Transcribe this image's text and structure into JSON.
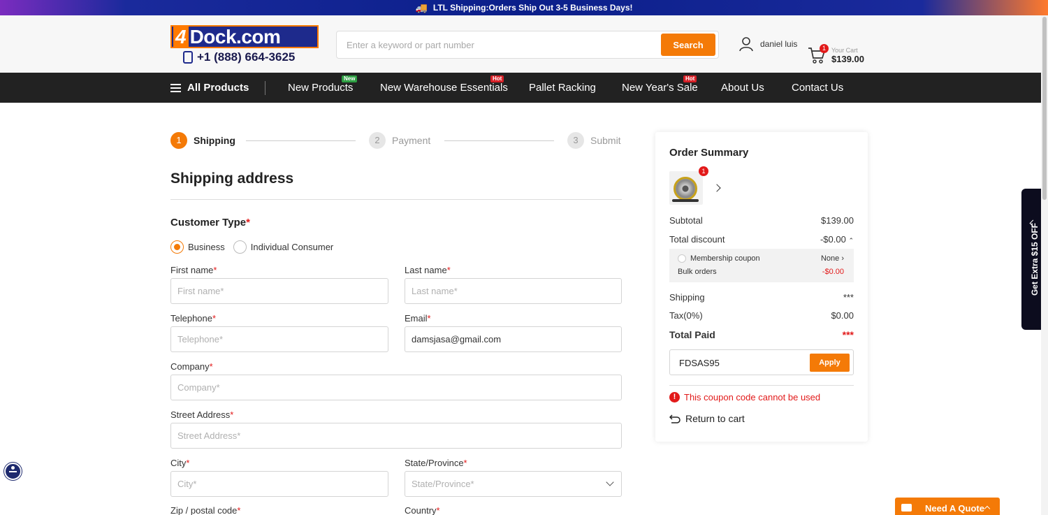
{
  "banner": {
    "text": "LTL Shipping:Orders Ship Out 3-5 Business Days!",
    "icon": "truck-icon"
  },
  "header": {
    "logo_text": "4Dock.com",
    "phone": "+1 (888) 664-3625",
    "search_placeholder": "Enter a keyword or part number",
    "search_button": "Search",
    "user_name": "daniel luis",
    "cart_count": "1",
    "cart_label": "Your Cart",
    "cart_total": "$139.00"
  },
  "nav": {
    "all_products": "All Products",
    "items": [
      {
        "label": "New Products",
        "badge": "New"
      },
      {
        "label": "New Warehouse Essentials",
        "badge": "Hot"
      },
      {
        "label": "Pallet Racking",
        "badge": ""
      },
      {
        "label": "New Year's Sale",
        "badge": "Hot"
      },
      {
        "label": "About Us",
        "badge": ""
      },
      {
        "label": "Contact Us",
        "badge": ""
      }
    ]
  },
  "steps": [
    {
      "num": "1",
      "label": "Shipping",
      "active": true
    },
    {
      "num": "2",
      "label": "Payment",
      "active": false
    },
    {
      "num": "3",
      "label": "Submit",
      "active": false
    }
  ],
  "form": {
    "title": "Shipping address",
    "customer_type_label": "Customer Type",
    "customer_types": [
      "Business",
      "Individual Consumer"
    ],
    "selected_customer_type": "Business",
    "first_name": {
      "label": "First name",
      "placeholder": "First name*",
      "value": ""
    },
    "last_name": {
      "label": "Last name",
      "placeholder": "Last name*",
      "value": ""
    },
    "telephone": {
      "label": "Telephone",
      "placeholder": "Telephone*",
      "value": ""
    },
    "email": {
      "label": "Email",
      "placeholder": "Email*",
      "value": "damsjasa@gmail.com"
    },
    "company": {
      "label": "Company",
      "placeholder": "Company*",
      "value": ""
    },
    "street": {
      "label": "Street Address",
      "placeholder": "Street Address*",
      "value": ""
    },
    "city": {
      "label": "City",
      "placeholder": "City*",
      "value": ""
    },
    "state": {
      "label": "State/Province",
      "placeholder": "State/Province*"
    },
    "zip": {
      "label": "Zip / postal code"
    },
    "country": {
      "label": "Country"
    },
    "required_mark": "*"
  },
  "summary": {
    "title": "Order Summary",
    "item_qty": "1",
    "subtotal_label": "Subtotal",
    "subtotal": "$139.00",
    "discount_label": "Total discount",
    "discount": "-$0.00",
    "membership_label": "Membership coupon",
    "membership_value": "None",
    "bulk_label": "Bulk orders",
    "bulk_value": "-$0.00",
    "shipping_label": "Shipping",
    "shipping": "***",
    "tax_label": "Tax(0%)",
    "tax": "$0.00",
    "total_label": "Total Paid",
    "total": "***",
    "coupon_value": "FDSAS95",
    "apply_label": "Apply",
    "error": "This coupon code cannot be used",
    "return_label": "Return to cart"
  },
  "side_tab": "Get Extra $15 OFF",
  "quote_label": "Need A Quote",
  "colors": {
    "accent": "#f47a07",
    "nav_bg": "#222222",
    "error": "#e21a1a",
    "brand_blue": "#1e2a8c"
  }
}
